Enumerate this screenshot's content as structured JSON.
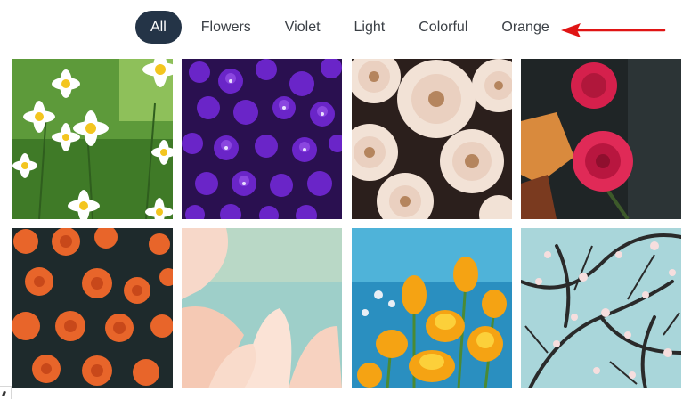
{
  "filters": [
    {
      "label": "All",
      "active": true
    },
    {
      "label": "Flowers",
      "active": false
    },
    {
      "label": "Violet",
      "active": false
    },
    {
      "label": "Light",
      "active": false
    },
    {
      "label": "Colorful",
      "active": false
    },
    {
      "label": "Orange",
      "active": false
    }
  ],
  "annotation": {
    "icon": "arrow-left-icon",
    "color": "#e01414"
  },
  "gallery": {
    "images": [
      {
        "name": "daisies-photo"
      },
      {
        "name": "violet-flowers-photo"
      },
      {
        "name": "white-chrysanthemums-photo"
      },
      {
        "name": "pink-roses-photo"
      },
      {
        "name": "orange-carnations-photo"
      },
      {
        "name": "soft-pink-petals-photo"
      },
      {
        "name": "yellow-poppies-photo"
      },
      {
        "name": "cherry-blossom-branches-photo"
      }
    ]
  },
  "colors": {
    "active_pill": "#243447",
    "text": "#3a3f45",
    "arrow": "#e01414"
  }
}
